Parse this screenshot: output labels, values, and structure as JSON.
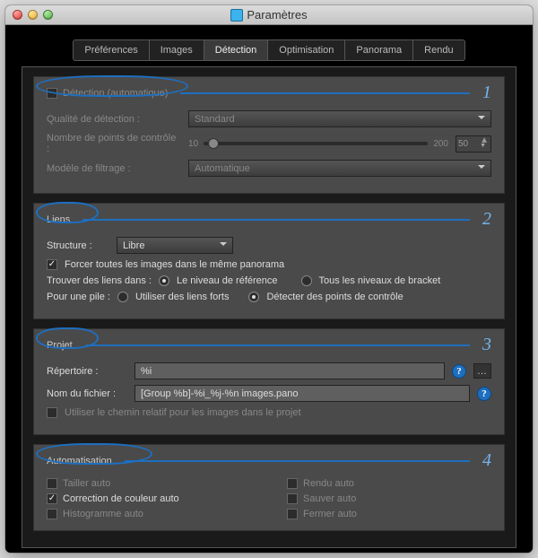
{
  "window": {
    "title": "Paramètres"
  },
  "tabs": [
    {
      "label": "Préférences"
    },
    {
      "label": "Images"
    },
    {
      "label": "Détection"
    },
    {
      "label": "Optimisation"
    },
    {
      "label": "Panorama"
    },
    {
      "label": "Rendu"
    }
  ],
  "annotations": {
    "n1": "1",
    "n2": "2",
    "n3": "3",
    "n4": "4"
  },
  "detection": {
    "heading": "Détection (automatique)",
    "quality_label": "Qualité de détection :",
    "quality_value": "Standard",
    "npoints_label": "Nombre de points de contrôle :",
    "npoints_min": "10",
    "npoints_max": "200",
    "npoints_value": "50",
    "filter_label": "Modèle de filtrage :",
    "filter_value": "Automatique"
  },
  "links": {
    "heading": "Liens",
    "structure_label": "Structure :",
    "structure_value": "Libre",
    "force_all": "Forcer toutes les images dans le même panorama",
    "find_label": "Trouver des liens dans :",
    "find_opt1": "Le niveau de référence",
    "find_opt2": "Tous les niveaux de bracket",
    "stack_label": "Pour une pile :",
    "stack_opt1": "Utiliser des liens forts",
    "stack_opt2": "Détecter des points de contrôle"
  },
  "project": {
    "heading": "Projet",
    "dir_label": "Répertoire :",
    "dir_value": "%i",
    "file_label": "Nom du fichier :",
    "file_value": "[Group %b]-%i_%j-%n images.pano",
    "relpath": "Utiliser le chemin relatif pour les images dans le projet"
  },
  "automation": {
    "heading": "Automatisation",
    "tailor": "Tailler auto",
    "color": "Correction de couleur auto",
    "hist": "Histogramme auto",
    "render": "Rendu auto",
    "save": "Sauver auto",
    "close": "Fermer auto"
  }
}
